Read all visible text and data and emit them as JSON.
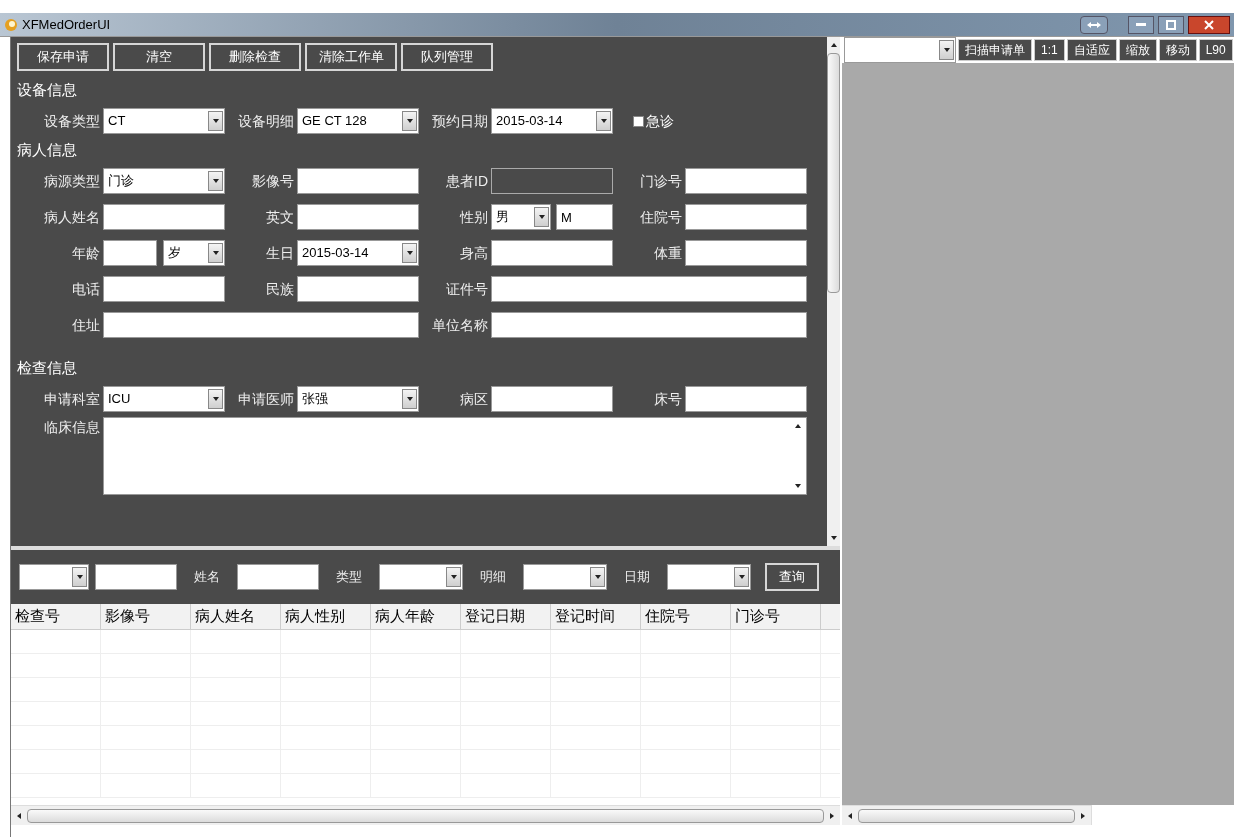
{
  "window": {
    "title": "XFMedOrderUI"
  },
  "toolbar": [
    "保存申请",
    "清空",
    "删除检查",
    "清除工作单",
    "队列管理"
  ],
  "sections": [
    {
      "title": "设备信息",
      "rows": [
        [
          {
            "label": "设备类型",
            "kind": "combo",
            "value": "CT"
          },
          {
            "label": "设备明细",
            "kind": "combo",
            "value": "GE CT 128"
          },
          {
            "label": "预约日期",
            "kind": "date",
            "value": "2015-03-14"
          },
          {
            "label": "急诊",
            "kind": "checkbox",
            "checked": false
          }
        ]
      ]
    },
    {
      "title": "病人信息",
      "rows": [
        [
          {
            "label": "病源类型",
            "kind": "combo",
            "value": "门诊"
          },
          {
            "label": "影像号",
            "kind": "text"
          },
          {
            "label": "患者ID",
            "kind": "readonly"
          },
          {
            "label": "门诊号",
            "kind": "text"
          }
        ],
        [
          {
            "label": "病人姓名",
            "kind": "text"
          },
          {
            "label": "英文",
            "kind": "text"
          },
          {
            "label": "性别",
            "kind": "pair",
            "value": "男",
            "extra": "M"
          },
          {
            "label": "住院号",
            "kind": "text"
          }
        ],
        [
          {
            "label": "年龄",
            "kind": "age",
            "unit": "岁"
          },
          {
            "label": "生日",
            "kind": "date",
            "value": "2015-03-14"
          },
          {
            "label": "身高",
            "kind": "text"
          },
          {
            "label": "体重",
            "kind": "text"
          }
        ],
        [
          {
            "label": "电话",
            "kind": "text"
          },
          {
            "label": "民族",
            "kind": "text"
          },
          {
            "label": "证件号",
            "kind": "text"
          },
          ""
        ],
        [
          {
            "label": "住址",
            "kind": "text"
          },
          "",
          {
            "label": "单位名称",
            "kind": "text"
          },
          ""
        ]
      ]
    },
    {
      "title": "检查信息",
      "rows": [
        [
          {
            "label": "申请科室",
            "kind": "combo",
            "value": "ICU"
          },
          {
            "label": "申请医师",
            "kind": "combo",
            "value": "张强"
          },
          {
            "label": "病区",
            "kind": "text"
          },
          {
            "label": "床号",
            "kind": "text"
          }
        ],
        [
          {
            "label": "临床信息",
            "kind": "textarea"
          },
          "",
          "",
          ""
        ]
      ]
    }
  ],
  "search_bar": {
    "fields": [
      {
        "kind": "combo"
      },
      {
        "kind": "text"
      },
      {
        "label": "姓名",
        "kind": "text"
      },
      {
        "label": "类型",
        "kind": "combo"
      },
      {
        "label": "明细",
        "kind": "combo"
      },
      {
        "label": "日期",
        "kind": "combo"
      }
    ],
    "button": "查询"
  },
  "table": {
    "columns": [
      "检查号",
      "影像号",
      "病人姓名",
      "病人性别",
      "病人年龄",
      "登记日期",
      "登记时间",
      "住院号",
      "门诊号"
    ]
  },
  "viewer": {
    "buttons": [
      "扫描申请单",
      "1:1",
      "自适应",
      "缩放",
      "移动",
      "L90"
    ]
  }
}
